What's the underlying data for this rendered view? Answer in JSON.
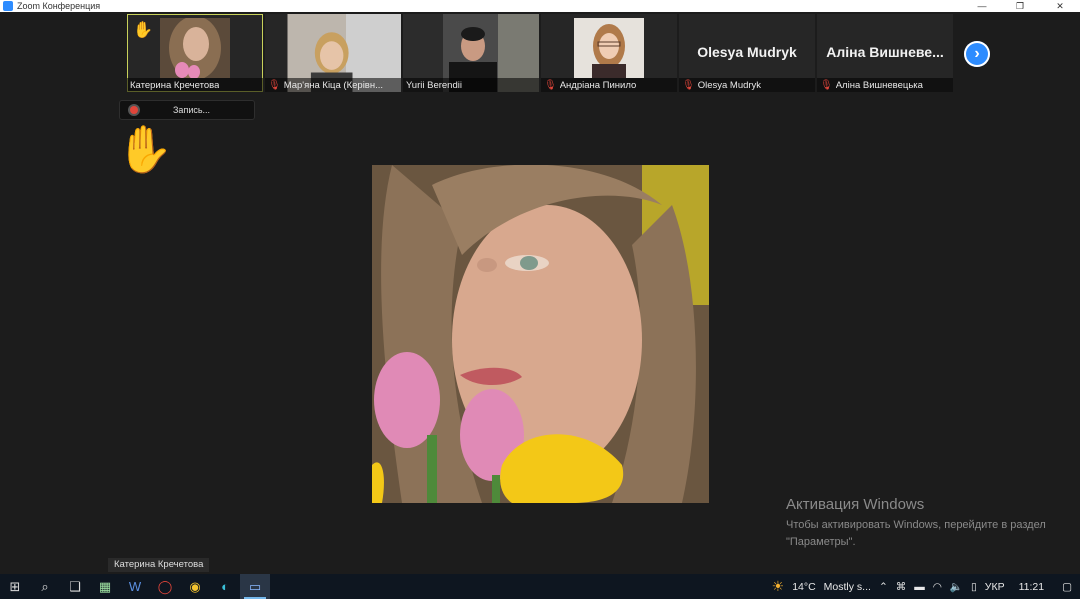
{
  "window": {
    "title": "Zoom Конференция",
    "controls": {
      "minimize": "—",
      "restore": "❐",
      "close": "✕"
    }
  },
  "participants": [
    {
      "name": "Катерина Кречетова",
      "muted": false,
      "raised_hand": true,
      "has_video": true
    },
    {
      "name": "Мар'яна Кіца (Керівн...",
      "muted": true,
      "raised_hand": false,
      "has_video": true
    },
    {
      "name": "Yurii Berendii",
      "muted": false,
      "raised_hand": false,
      "has_video": true
    },
    {
      "name": "Андріана Пинило",
      "muted": true,
      "raised_hand": false,
      "has_video": true
    },
    {
      "name": "Olesya Mudryk",
      "muted": true,
      "raised_hand": false,
      "has_video": false,
      "display_name": "Olesya Mudryk"
    },
    {
      "name": "Аліна Вишневецька",
      "muted": true,
      "raised_hand": false,
      "has_video": false,
      "display_name": "Аліна Вишневе..."
    }
  ],
  "recording": {
    "label": "Запись..."
  },
  "activation": {
    "heading": "Активация Windows",
    "sub": "Чтобы активировать Windows, перейдите в раздел \"Параметры\"."
  },
  "tooltip": "Катерина Кречетова",
  "taskbar": {
    "weather_temp": "14°C",
    "weather_text": "Mostly s...",
    "lang": "УКР",
    "time": "11:21"
  },
  "colors": {
    "accent": "#2d8cff",
    "muted_mic": "#e0453a",
    "active_border": "#c8d15a"
  }
}
